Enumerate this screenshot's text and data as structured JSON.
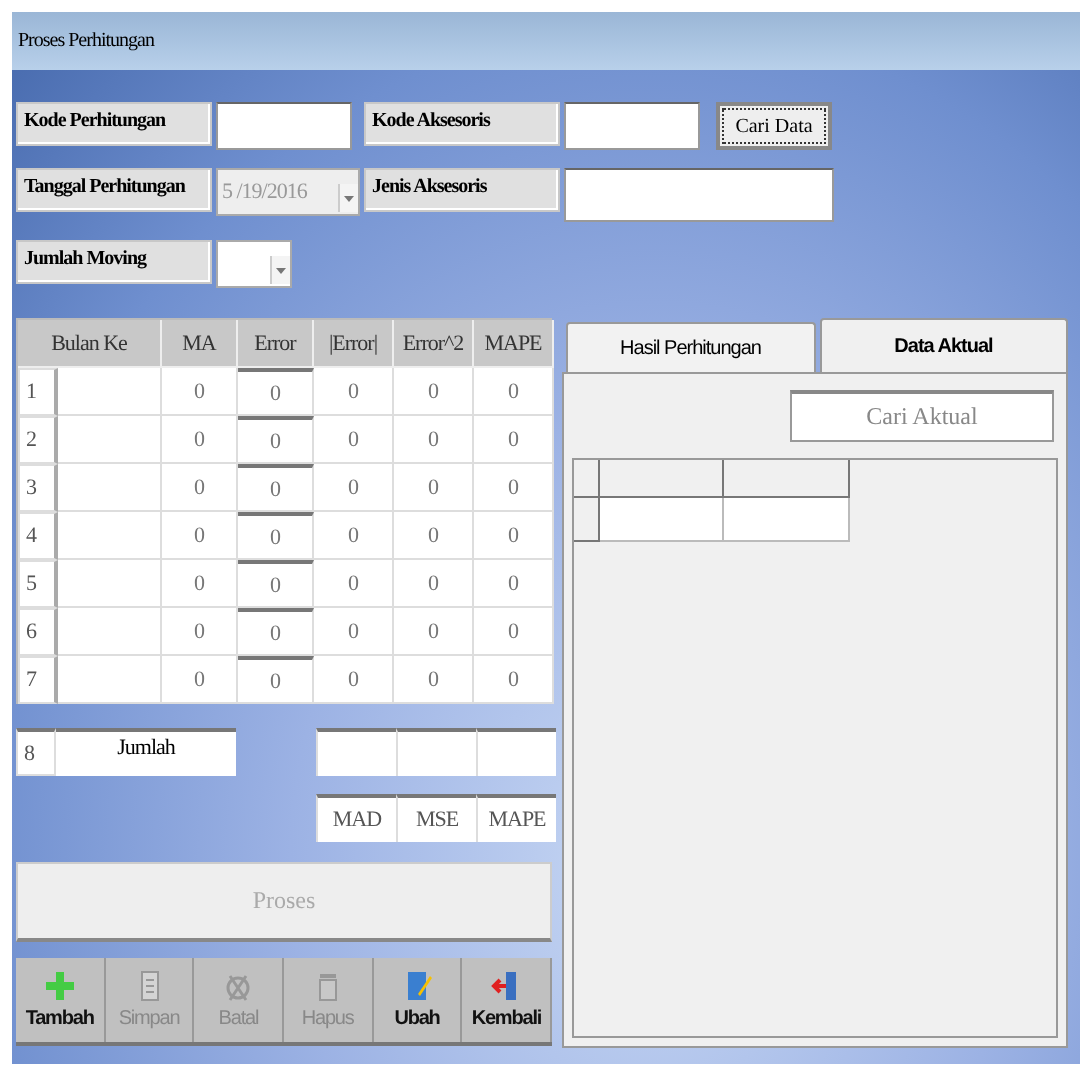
{
  "window": {
    "title": "Proses Perhitungan"
  },
  "form": {
    "rows": [
      {
        "fields": [
          {
            "kind": "text",
            "label": "Kode Perhitungan"
          },
          {
            "kind": "text",
            "label": "Kode Aksesoris"
          }
        ],
        "button": {
          "label": "Cari Data"
        }
      },
      {
        "fields": [
          {
            "kind": "date",
            "label": "Tanggal Perhitungan",
            "value": "5 /19/2016",
            "disabled": true
          },
          {
            "kind": "wide",
            "label": "Jenis Aksesoris"
          }
        ]
      },
      {
        "fields": [
          {
            "kind": "combo",
            "label": "Jumlah Moving",
            "disabled": false
          }
        ]
      }
    ]
  },
  "table": {
    "columns": [
      "Bulan Ke",
      "MA",
      "Error",
      "|Error|",
      "Error^2",
      "MAPE"
    ],
    "rows": [
      {
        "number": "1",
        "cells": [
          "",
          "0",
          "0",
          "0",
          "0",
          "0"
        ]
      },
      {
        "number": "2",
        "cells": [
          "",
          "0",
          "0",
          "0",
          "0",
          "0"
        ]
      },
      {
        "number": "3",
        "cells": [
          "",
          "0",
          "0",
          "0",
          "0",
          "0"
        ]
      },
      {
        "number": "4",
        "cells": [
          "",
          "0",
          "0",
          "0",
          "0",
          "0"
        ]
      },
      {
        "number": "5",
        "cells": [
          "",
          "0",
          "0",
          "0",
          "0",
          "0"
        ]
      },
      {
        "number": "6",
        "cells": [
          "",
          "0",
          "0",
          "0",
          "0",
          "0"
        ]
      },
      {
        "number": "7",
        "cells": [
          "",
          "0",
          "0",
          "0",
          "0",
          "0"
        ]
      }
    ],
    "summary": {
      "number": "8",
      "label": "Jumlah",
      "captions": [
        "MAD",
        "MSE",
        "MAPE"
      ]
    }
  },
  "process_button": {
    "label": "Proses",
    "disabled": true
  },
  "toolbar": [
    {
      "kind": "add",
      "label": "Tambah",
      "disabled": false
    },
    {
      "kind": "save",
      "label": "Simpan",
      "disabled": true
    },
    {
      "kind": "cancel",
      "label": "Batal",
      "disabled": true
    },
    {
      "kind": "delete",
      "label": "Hapus",
      "disabled": true
    },
    {
      "kind": "edit",
      "label": "Ubah",
      "disabled": false
    },
    {
      "kind": "exit",
      "label": "Kembali",
      "disabled": false
    }
  ],
  "tabs": [
    {
      "label": "Hasil Perhitungan",
      "selected": false
    },
    {
      "label": "Data Aktual",
      "selected": true
    }
  ],
  "search": {
    "placeholder": "Cari Aktual"
  }
}
